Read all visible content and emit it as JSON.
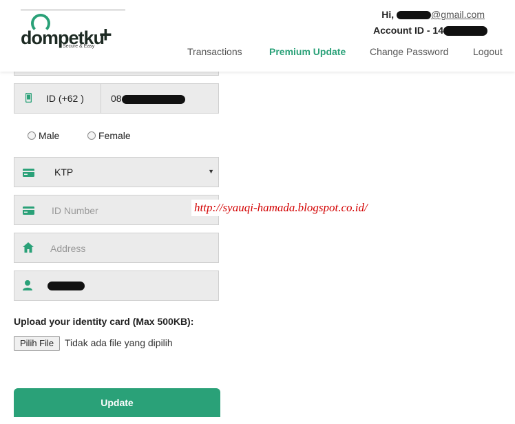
{
  "header": {
    "logo_text": "dompetku",
    "logo_plus": "+",
    "logo_tagline": "Secure & Easy",
    "greeting_prefix": "Hi, ",
    "email_suffix": "@gmail.com",
    "account_prefix": "Account ID - 14"
  },
  "nav": {
    "transactions": "Transactions",
    "premium_update": "Premium Update",
    "change_password": "Change Password",
    "logout": "Logout"
  },
  "form": {
    "phone_code": "ID (+62 )",
    "phone_prefix": "08",
    "gender_male": "Male",
    "gender_female": "Female",
    "id_type": "KTP",
    "id_number_placeholder": "ID Number",
    "address_placeholder": "Address",
    "upload_label": "Upload your identity card (Max 500KB):",
    "file_button": "Pilih File",
    "file_status": "Tidak ada file yang dipilih",
    "submit": "Update"
  },
  "watermark": "http://syauqi-hamada.blogspot.co.id/",
  "colors": {
    "accent": "#2aa178",
    "field_bg": "#ebebeb",
    "watermark": "#d30000"
  }
}
